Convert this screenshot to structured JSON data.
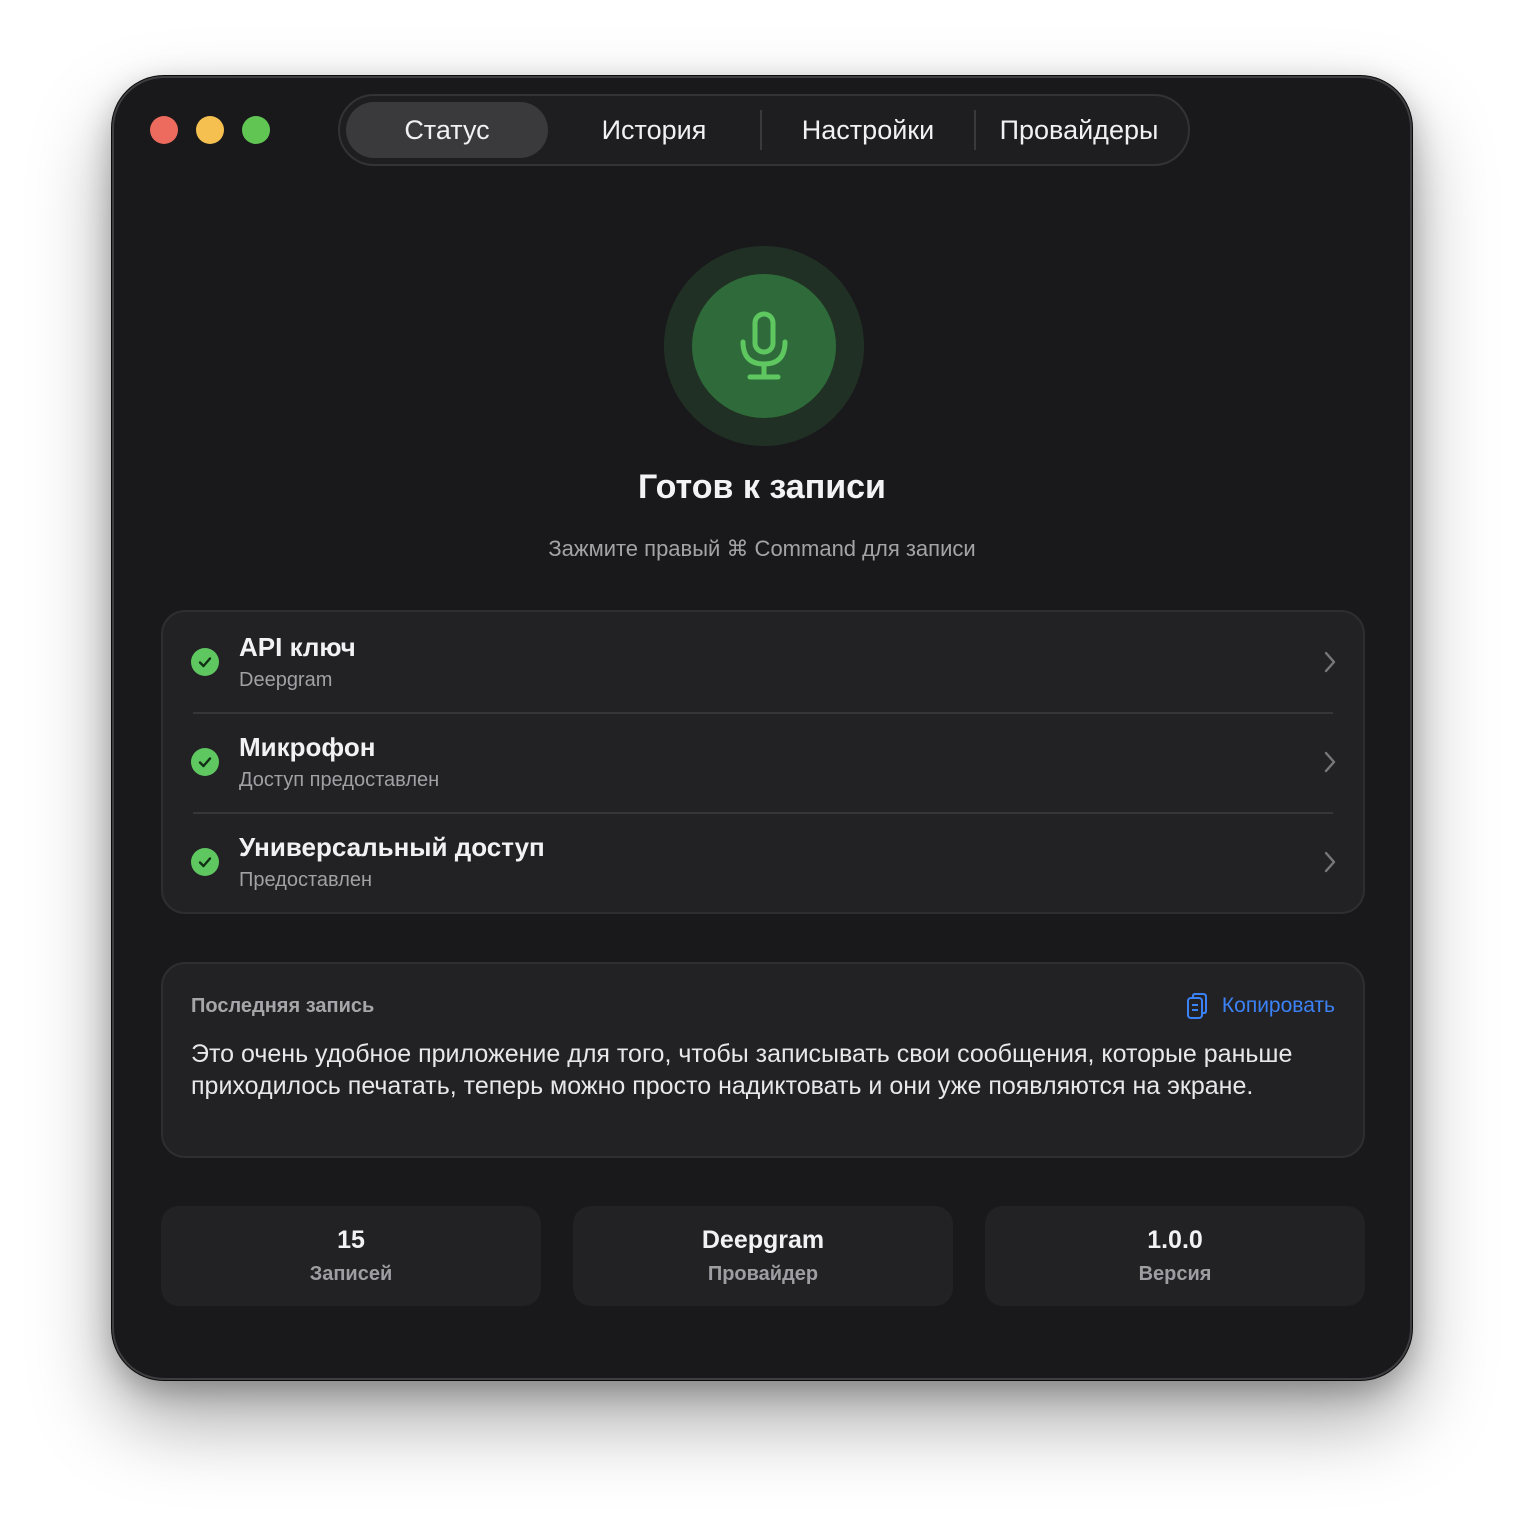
{
  "tabs": [
    {
      "label": "Статус",
      "active": true
    },
    {
      "label": "История",
      "active": false
    },
    {
      "label": "Настройки",
      "active": false
    },
    {
      "label": "Провайдеры",
      "active": false
    }
  ],
  "status": {
    "title": "Готов к записи",
    "subtitle": "Зажмите правый ⌘ Command для записи",
    "accent_color": "#5ec760"
  },
  "checks": [
    {
      "title": "API ключ",
      "subtitle": "Deepgram"
    },
    {
      "title": "Микрофон",
      "subtitle": "Доступ предоставлен"
    },
    {
      "title": "Универсальный доступ",
      "subtitle": "Предоставлен"
    }
  ],
  "last_record": {
    "label": "Последняя запись",
    "copy_label": "Копировать",
    "text": "Это очень удобное приложение для того, чтобы записывать свои сообщения, которые раньше приходилось печатать, теперь можно просто надиктовать и они уже появляются на экране."
  },
  "stats": [
    {
      "value": "15",
      "label": "Записей"
    },
    {
      "value": "Deepgram",
      "label": "Провайдер"
    },
    {
      "value": "1.0.0",
      "label": "Версия"
    }
  ],
  "icons": {
    "mic": "microphone-icon",
    "check": "checkmark-circle-icon",
    "chevron": "chevron-right-icon",
    "copy": "copy-icon"
  },
  "colors": {
    "link": "#3b82f6",
    "window_bg": "#19191b"
  }
}
